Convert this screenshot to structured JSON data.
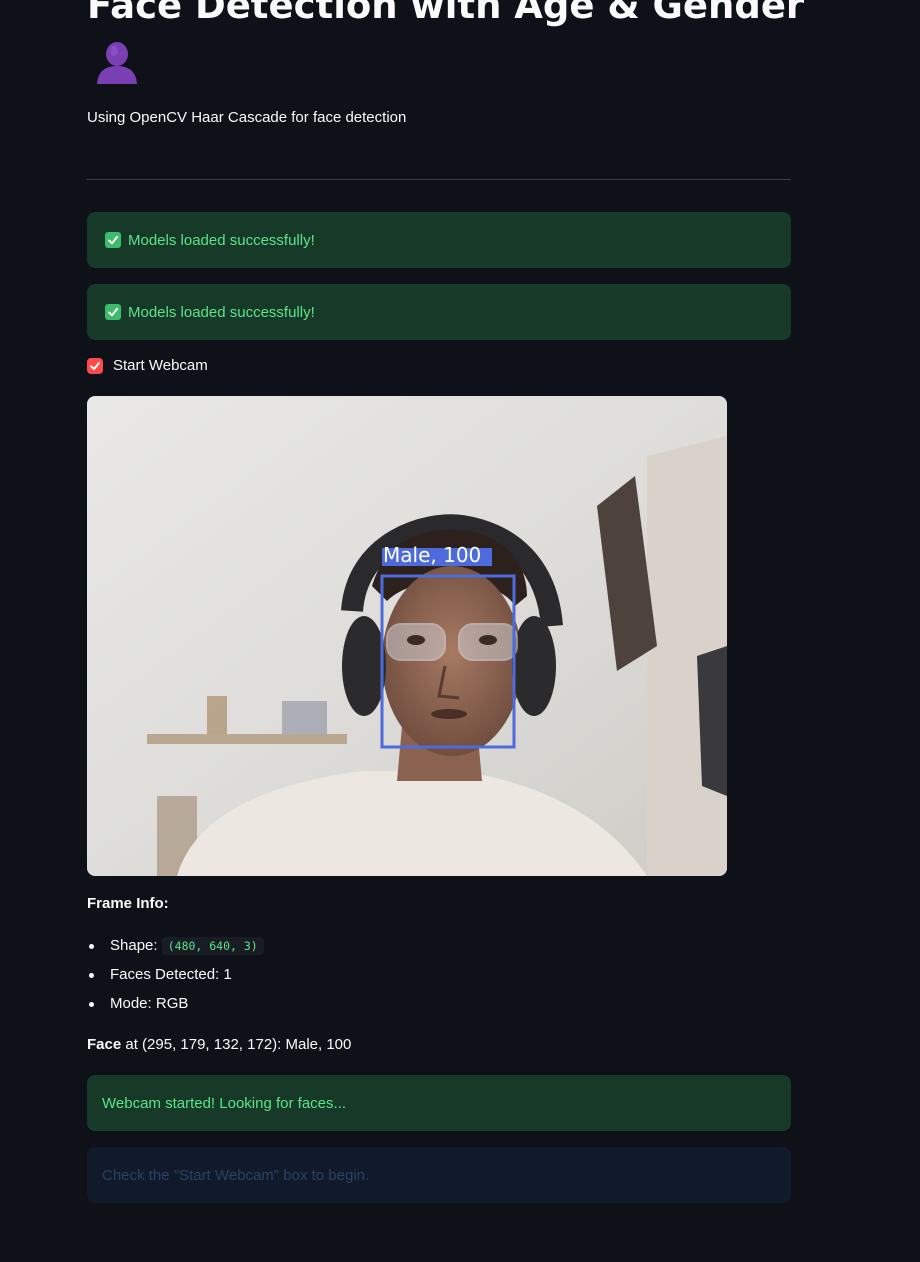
{
  "page": {
    "title": "Face Detection with Age & Gender",
    "title_emoji": "bust-in-silhouette",
    "subtitle": "Using OpenCV Haar Cascade for face detection"
  },
  "alerts": {
    "models_loaded_1": "Models loaded successfully!",
    "models_loaded_2": "Models loaded successfully!",
    "webcam_started": "Webcam started! Looking for faces...",
    "hint": "Check the \"Start Webcam\" box to begin."
  },
  "webcam_toggle": {
    "label": "Start Webcam",
    "checked": true
  },
  "webcam_frame": {
    "detection_label": "Male, 100",
    "box_color": "#4d6bdb"
  },
  "frame_info": {
    "heading": "Frame Info:",
    "shape_label": "Shape:",
    "shape_value": "(480, 640, 3)",
    "faces_detected": "Faces Detected: 1",
    "mode": "Mode: RGB"
  },
  "face_result": {
    "bold": "Face",
    "text": " at (295, 179, 132, 172): Male, 100"
  },
  "colors": {
    "background": "#0e1117",
    "success_bg": "#173928",
    "success_text": "#5ce488",
    "checkbox": "#ff4b4b",
    "info_bg": "#111a2b"
  }
}
